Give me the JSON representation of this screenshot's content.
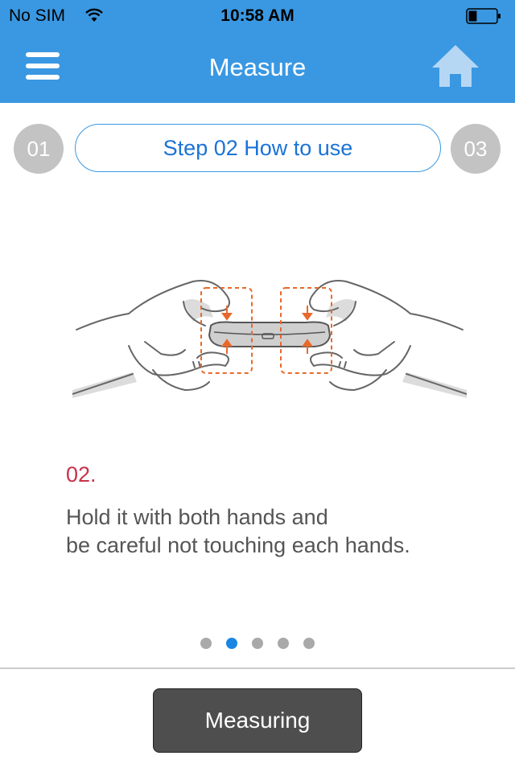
{
  "status_bar": {
    "carrier": "No SIM",
    "time": "10:58 AM",
    "battery_level": 0.3
  },
  "nav": {
    "title": "Measure",
    "menu_icon": "hamburger-menu-icon",
    "home_icon": "home-icon"
  },
  "steps": {
    "prev_label": "01",
    "current_label": "Step 02 How to use",
    "next_label": "03"
  },
  "content": {
    "step_number": "02.",
    "description_line1": "Hold it with both hands and",
    "description_line2": "be careful not touching each hands."
  },
  "pagination": {
    "total": 5,
    "active_index": 1
  },
  "footer": {
    "button_label": "Measuring"
  },
  "colors": {
    "header_bg": "#3a98e2",
    "accent": "#1a73d6",
    "step_number": "#c8314a",
    "dot_active": "#1a86e4",
    "dot_inactive": "#a9a9a9",
    "illustration_accent": "#e8692b"
  }
}
